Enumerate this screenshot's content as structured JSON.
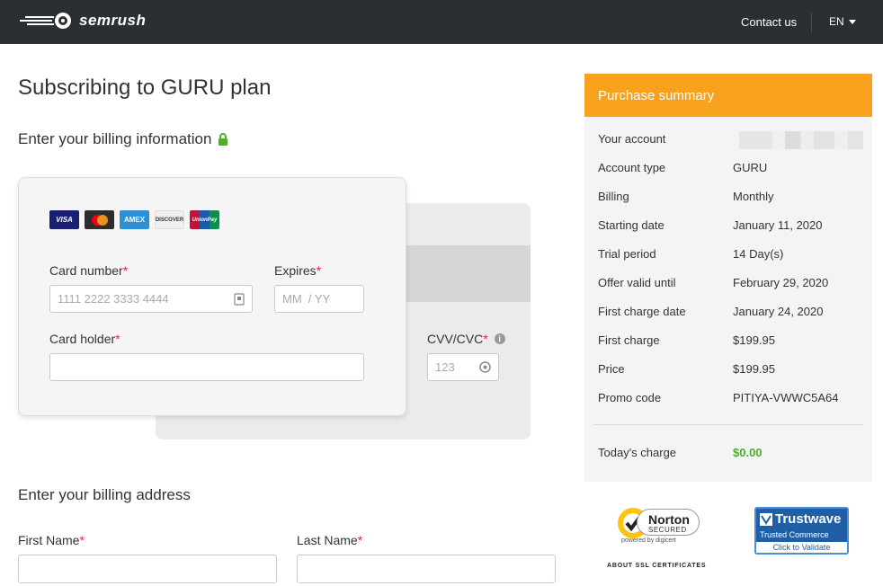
{
  "header": {
    "brand": "semrush",
    "contact_label": "Contact us",
    "language": "EN"
  },
  "page_title": "Subscribing to GURU plan",
  "billing_info_title": "Enter your billing information",
  "card_brands": [
    "VISA",
    "MC",
    "AMEX",
    "DISCOVER",
    "UnionPay"
  ],
  "card_form": {
    "card_number_label": "Card number",
    "card_number_placeholder": "1111 2222 3333 4444",
    "expires_label": "Expires",
    "expires_placeholder": "MM  / YY",
    "card_holder_label": "Card holder",
    "cvv_label": "CVV/CVC",
    "cvv_placeholder": "123",
    "required_mark": "*"
  },
  "billing_address": {
    "title": "Enter your billing address",
    "first_name_label": "First Name",
    "last_name_label": "Last Name"
  },
  "summary": {
    "title": "Purchase summary",
    "rows": [
      {
        "label": "Your account",
        "value": ""
      },
      {
        "label": "Account type",
        "value": "GURU"
      },
      {
        "label": "Billing",
        "value": "Monthly"
      },
      {
        "label": "Starting date",
        "value": "January 11, 2020"
      },
      {
        "label": "Trial period",
        "value": "14 Day(s)"
      },
      {
        "label": "Offer valid until",
        "value": "February 29, 2020"
      },
      {
        "label": "First charge date",
        "value": "January 24, 2020"
      },
      {
        "label": "First charge",
        "value": "$199.95"
      },
      {
        "label": "Price",
        "value": "$199.95"
      },
      {
        "label": "Promo code",
        "value": "PITIYA-VWWC5A64"
      }
    ],
    "today_label": "Today's charge",
    "today_value": "$0.00"
  },
  "badges": {
    "norton_title": "Norton",
    "norton_sub": "SECURED",
    "norton_powered": "powered by digicert",
    "about_ssl": "ABOUT SSL CERTIFICATES",
    "trustwave_title": "Trustwave",
    "trustwave_sub": "Trusted Commerce",
    "trustwave_link": "Click to Validate"
  },
  "colors": {
    "header_bg": "#2b2e33",
    "summary_accent": "#f7a11c",
    "required": "#e0282e",
    "success": "#4caf28"
  }
}
